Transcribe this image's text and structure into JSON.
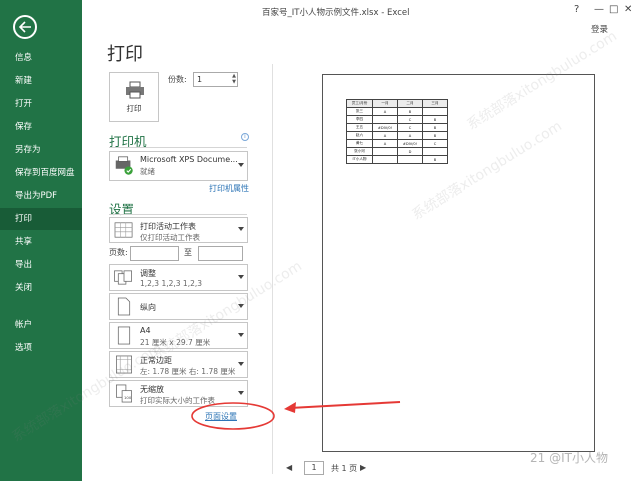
{
  "window": {
    "title": "百家号_IT小人物示例文件.xlsx - Excel",
    "controls": [
      "?",
      "—",
      "□",
      "✕"
    ],
    "login": "登录"
  },
  "sidebar": {
    "items": [
      {
        "label": "信息"
      },
      {
        "label": "新建"
      },
      {
        "label": "打开"
      },
      {
        "label": "保存"
      },
      {
        "label": "另存为"
      },
      {
        "label": "保存到百度网盘"
      },
      {
        "label": "导出为PDF"
      },
      {
        "label": "打印",
        "active": true
      },
      {
        "label": "共享"
      },
      {
        "label": "导出"
      },
      {
        "label": "关闭"
      },
      {
        "label": "帐户"
      },
      {
        "label": "选项"
      }
    ]
  },
  "print": {
    "title": "打印",
    "print_button": "打印",
    "copies_label": "份数:",
    "copies_value": "1"
  },
  "printer": {
    "heading": "打印机",
    "name": "Microsoft XPS Docume...",
    "status": "就绪",
    "properties_link": "打印机属性",
    "info": "i"
  },
  "settings": {
    "heading": "设置",
    "scope": {
      "title": "打印活动工作表",
      "subtitle": "仅打印活动工作表"
    },
    "pages_label": "页数:",
    "pages_to": "至",
    "collate": {
      "title": "调整",
      "subtitle": "1,2,3    1,2,3    1,2,3"
    },
    "orientation": {
      "title": "纵向"
    },
    "paper": {
      "title": "A4",
      "subtitle": "21 厘米 x 29.7 厘米"
    },
    "margins": {
      "title": "正常边距",
      "subtitle": "左: 1.78 厘米    右: 1.78 厘米"
    },
    "scaling": {
      "title": "无缩放",
      "subtitle": "打印实际大小的工作表"
    },
    "page_setup_link": "页面设置"
  },
  "preview": {
    "table": [
      [
        "员工/月份",
        "一月",
        "二月",
        "三月"
      ],
      [
        "张三",
        "A",
        "B",
        ""
      ],
      [
        "李四",
        "",
        "C",
        "B"
      ],
      [
        "王五",
        "#DIV/0!",
        "C",
        "B"
      ],
      [
        "赵六",
        "A",
        "A",
        "B"
      ],
      [
        "黄七",
        "A",
        "#DIV/0!",
        "C"
      ],
      [
        "张小河",
        "",
        "D",
        ""
      ],
      [
        "IT小人物",
        "",
        "",
        "B"
      ]
    ],
    "page_current": "1",
    "page_total": "共 1 页"
  },
  "watermark": {
    "text": "系统部落xitongbuluo.com",
    "corner": "21 @IT小人物"
  },
  "colors": {
    "accent": "#217346",
    "annotation": "#e53935",
    "link": "#2e75b6"
  }
}
